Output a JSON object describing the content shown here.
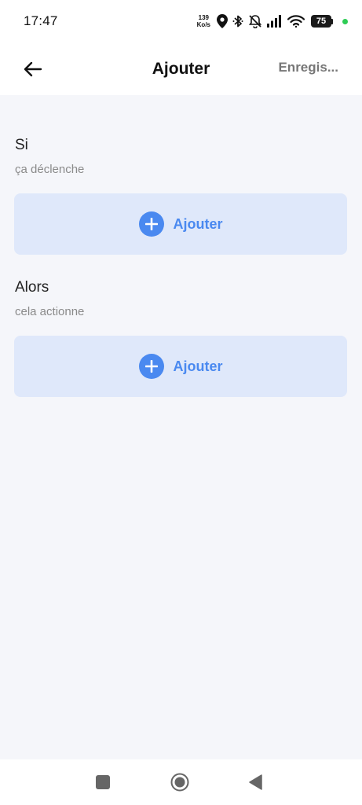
{
  "status_bar": {
    "time": "17:47",
    "net_speed_value": "139",
    "net_speed_unit": "Ko/s",
    "battery_level": "75",
    "icons": [
      "location-icon",
      "bluetooth-icon",
      "bell-muted-icon",
      "signal-icon",
      "wifi-icon",
      "battery-icon",
      "charging-dot"
    ],
    "charge_color": "#2ecc55"
  },
  "app_bar": {
    "title": "Ajouter",
    "save_label": "Enregis..."
  },
  "sections": [
    {
      "title": "Si",
      "subtitle": "ça déclenche",
      "add_label": "Ajouter"
    },
    {
      "title": "Alors",
      "subtitle": "cela actionne",
      "add_label": "Ajouter"
    }
  ],
  "nav_bar": {
    "icons": [
      "recents-icon",
      "home-icon",
      "back-icon"
    ]
  },
  "colors": {
    "accent": "#4a89f0",
    "card_bg": "#dfe8fa",
    "page_bg": "#f5f6fa"
  }
}
